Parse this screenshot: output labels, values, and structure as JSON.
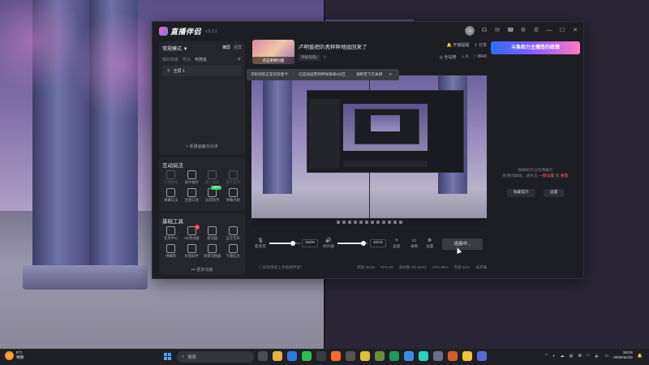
{
  "app": {
    "name": "直播伴侣",
    "version": "v.5.3.2"
  },
  "scenes": {
    "mode": "常规模式 ▼",
    "tabs": [
      "横屏",
      "竖屏"
    ],
    "sub_tabs": [
      "我的场景",
      "导出",
      "可改名"
    ],
    "add": "+",
    "item": "全屏 1",
    "new_scene": "+ 新建画面对对讲"
  },
  "interact": {
    "title": "互动玩法",
    "items": [
      {
        "label": "礼物特效",
        "dim": true
      },
      {
        "label": "观众抽奖",
        "dim": false
      },
      {
        "label": "超人运动",
        "dim": true
      },
      {
        "label": "观众签到",
        "dim": true
      },
      {
        "label": "弹幕玩法",
        "dim": false
      },
      {
        "label": "连麦口语",
        "dim": false
      },
      {
        "label": "玩转助手",
        "dim": false,
        "badge": "NEW"
      },
      {
        "label": "弹幕点歌",
        "dim": false
      }
    ]
  },
  "tools": {
    "title": "基础工具",
    "items": [
      {
        "label": "任务中心",
        "badge": ""
      },
      {
        "label": "AB测试器",
        "badge": "1"
      },
      {
        "label": "提词器",
        "badge": ""
      },
      {
        "label": "正在音乐",
        "badge": ""
      },
      {
        "label": "弹幕库",
        "badge": ""
      },
      {
        "label": "房管助手",
        "badge": ""
      },
      {
        "label": "场景切换器",
        "badge": ""
      },
      {
        "label": "下播信息",
        "badge": ""
      }
    ],
    "more": "••• 更多功能"
  },
  "room": {
    "cover_label": "点击更换封面",
    "title": "卢明俊把叭秃秤秤地拢回来了",
    "tag": "神秘海域4",
    "actions": [
      "开播提醒",
      "分享"
    ],
    "stats": [
      "全站榜",
      "0",
      "8043"
    ]
  },
  "notice": {
    "text1": "识别到您正在玩双窗卡",
    "text2": "已自动运营到神秘海域4分区",
    "text3": "请移至下方关闭",
    "close": "✕"
  },
  "controls": {
    "mic_label": "麦克风",
    "mic_pct": "150%",
    "mic_level": 0.75,
    "speaker_label": "扬声器",
    "speaker_pct": "101%",
    "speaker_level": 0.85,
    "beauty": "美颜",
    "record": "录制",
    "settings": "设置",
    "connect": "连接中..."
  },
  "status": {
    "hint": "如何快速上手直播伴侣？",
    "items": [
      "网速 0Kb/s",
      "FPS 60",
      "丢帧数 0(0.00%)",
      "CPU 35%",
      "内存 46%",
      "未开播"
    ]
  },
  "right": {
    "promo": "斗鱼助力主播签约政策",
    "msg1": "弹幕助手已启用展示",
    "msg2": "新便同屏等，请点击 ",
    "msg_link1": "一键设置",
    "msg_or": " 或 ",
    "msg_link2": "重置",
    "btn1": "隐藏提示",
    "btn2": "设置"
  },
  "taskbar": {
    "temp": "5°C",
    "weather": "晴朗",
    "search": "搜索",
    "lang": "中",
    "time": "19:04",
    "date": "2025/11/22"
  },
  "colors": {
    "accent_pink": "#ff5bb0",
    "badge_red": "#ff3b4e",
    "badge_green": "#2ecc71",
    "link_red": "#ff5a5a"
  }
}
